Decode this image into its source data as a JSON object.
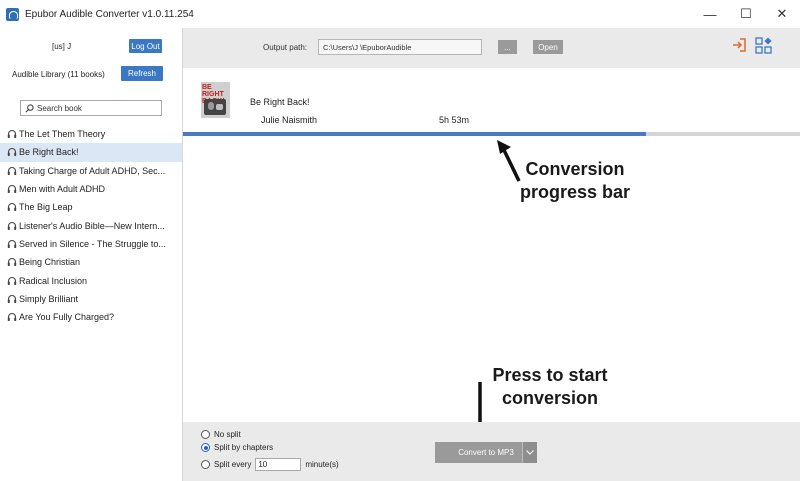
{
  "window": {
    "title": "Epubor Audible Converter v1.0.11.254",
    "controls": [
      "—",
      "☐",
      "✕"
    ]
  },
  "sidebar": {
    "user_label": "[us] J",
    "logout_label": "Log Out",
    "library_label": "Audible Library (11 books)",
    "refresh_label": "Refresh",
    "search_placeholder": "Search book",
    "books": [
      "The Let Them Theory",
      "Be Right Back!",
      "Taking Charge of Adult ADHD, Sec...",
      "Men with Adult ADHD",
      "The Big Leap",
      "Listener's Audio Bible—New Intern...",
      "Served in Silence - The Struggle to...",
      "Being Christian",
      "Radical Inclusion",
      "Simply Brilliant",
      "Are You Fully Charged?"
    ],
    "selected_index": 1
  },
  "toolbar": {
    "output_label": "Output path:",
    "output_path": "C:\\Users\\J    \\EpuborAudible",
    "browse_label": "...",
    "open_label": "Open"
  },
  "main": {
    "book": {
      "cover_text": "BE RIGHT BACK!",
      "title": "Be Right Back!",
      "author": "Julie Naismith",
      "duration": "5h 53m",
      "progress": 0.75
    }
  },
  "annotations": {
    "progress_note": "Conversion progress bar",
    "convert_note": "Press to start conversion"
  },
  "bottom": {
    "no_split": "No split",
    "split_chapters": "Split by chapters",
    "split_every": "Split every",
    "split_value": "10",
    "minute_label": "minute(s)",
    "convert_label": "Convert to MP3"
  },
  "colors": {
    "accent": "#3b78c4",
    "progress": "#4a79c7",
    "login_icon": "#e0692f"
  }
}
